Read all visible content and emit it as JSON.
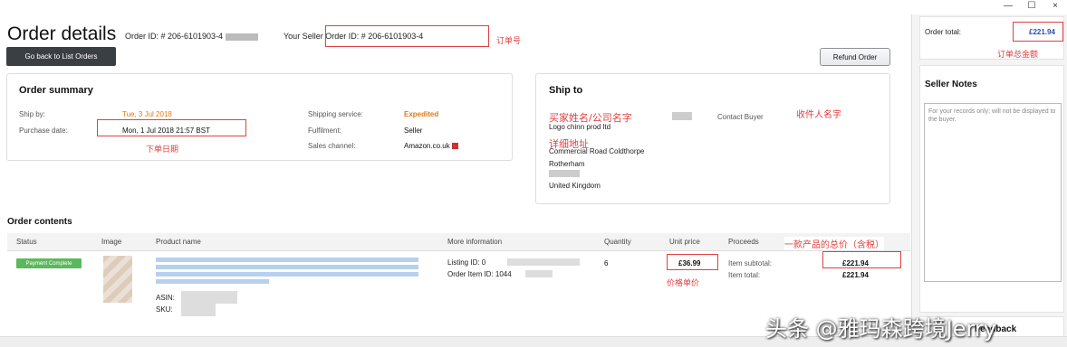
{
  "window": {
    "minimize": "—",
    "maximize": "☐",
    "close": "×"
  },
  "header": {
    "title": "Order details",
    "order_id_label": "Order ID: # 206-6101903-4",
    "your_ref_label": "Your Seller Order ID: # 206-6101903-4"
  },
  "annotations": {
    "order_number": "订单号",
    "order_date": "下单日期",
    "buyer_name": "买家姓名/公司名字",
    "detailed_address": "详细地址",
    "recipient_name": "收件人名字",
    "unit_price": "价格单价",
    "product_total": "一款产品的总价（含税）",
    "total_amount": "订单总金额"
  },
  "buttons": {
    "back": "Go back to List Orders",
    "refund": "Refund Order"
  },
  "order_summary": {
    "title": "Order summary",
    "ship_by_label": "Ship by:",
    "ship_by_value": "Tue, 3 Jul 2018",
    "purchase_date_label": "Purchase date:",
    "purchase_date_value": "Mon, 1 Jul 2018 21:57 BST",
    "shipping_service_label": "Shipping service:",
    "shipping_service_value": "Expedited",
    "fulfilment_label": "Fulfilment:",
    "fulfilment_value": "Seller",
    "sales_channel_label": "Sales channel:",
    "sales_channel_value": "Amazon.co.uk"
  },
  "ship_to": {
    "title": "Ship to",
    "line1": "Logo chinn prod ltd",
    "line2": "Commercial Road Coldthorpe",
    "line3": "Rotherham",
    "line4": "United Kingdom",
    "contact_buyer": "Contact Buyer"
  },
  "order_contents": {
    "title": "Order contents",
    "columns": [
      "Status",
      "Image",
      "Product name",
      "More information",
      "Quantity",
      "Unit price",
      "Proceeds"
    ],
    "row": {
      "status": "Payment Complete",
      "asin_label": "ASIN:",
      "sku_label": "SKU:",
      "listing_id": "Listing ID: 0",
      "order_item_id": "Order Item ID: 1044",
      "quantity": "6",
      "unit_price": "£36.99",
      "item_subtotal_label": "Item subtotal:",
      "item_subtotal_value": "£221.94",
      "item_total_label": "Item total:",
      "item_total_value": "£221.94"
    }
  },
  "sidebar": {
    "order_total_label": "Order total:",
    "order_total_value": "£221.94",
    "seller_notes_title": "Seller Notes",
    "notes_placeholder": "For your records only; will not be displayed to the buyer.",
    "feedback_label": "Feedback"
  },
  "watermark": "头条 @雅玛森跨境Jerry"
}
